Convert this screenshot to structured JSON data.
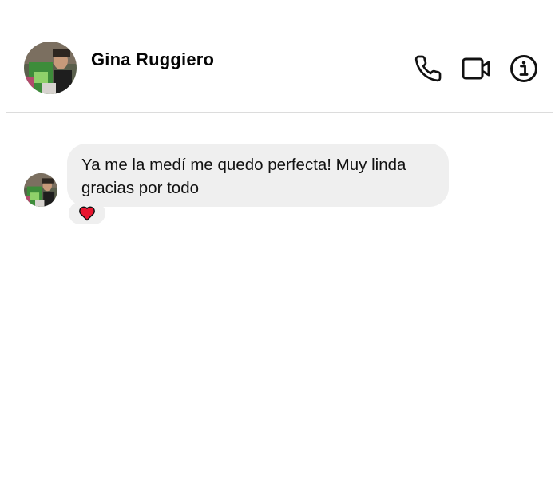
{
  "contact": {
    "name": "Gina Ruggiero"
  },
  "header": {
    "actions": [
      {
        "icon": "phone-icon",
        "label": "call"
      },
      {
        "icon": "video-camera-icon",
        "label": "video"
      },
      {
        "icon": "info-icon",
        "label": "info"
      }
    ]
  },
  "messages": [
    {
      "text": "Ya me la medí me quedo perfecta! Muy linda gracias por todo",
      "reaction": {
        "icon": "heart-icon",
        "color": "#e8162f"
      }
    }
  ],
  "colors": {
    "bubble_background": "#efefef",
    "text": "#111111",
    "divider": "#dcdcdc",
    "reaction_heart": "#e8162f"
  }
}
